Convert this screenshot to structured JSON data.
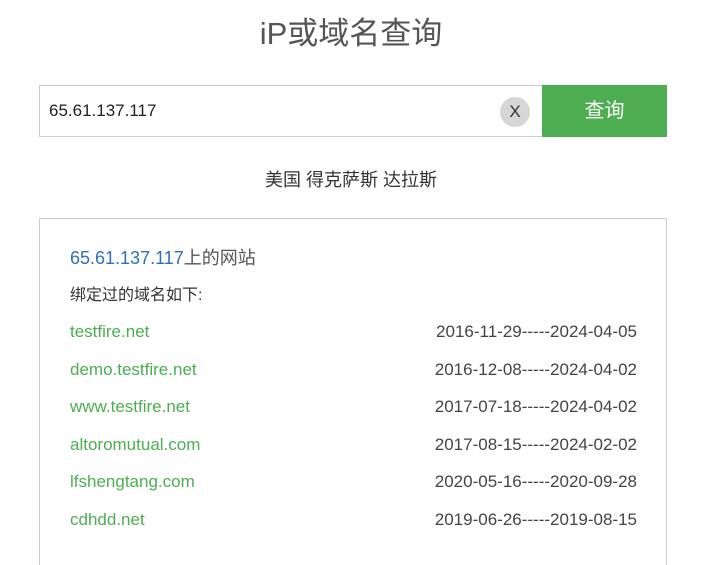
{
  "page": {
    "title": "iP或域名查询"
  },
  "search": {
    "value": "65.61.137.117",
    "clear_label": "X",
    "button_label": "查询"
  },
  "location": "美国 得克萨斯 达拉斯",
  "results": {
    "heading_ip": "65.61.137.117",
    "heading_suffix": "上的网站",
    "bound_label": "绑定过的域名如下:",
    "domains": [
      {
        "name": "testfire.net",
        "dates": "2016-11-29-----2024-04-05"
      },
      {
        "name": "demo.testfire.net",
        "dates": "2016-12-08-----2024-04-02"
      },
      {
        "name": "www.testfire.net",
        "dates": "2017-07-18-----2024-04-02"
      },
      {
        "name": "altoromutual.com",
        "dates": "2017-08-15-----2024-02-02"
      },
      {
        "name": "lfshengtang.com",
        "dates": "2020-05-16-----2020-09-28"
      },
      {
        "name": "cdhdd.net",
        "dates": "2019-06-26-----2019-08-15"
      }
    ]
  },
  "colors": {
    "accent_green": "#4cae50",
    "link_blue": "#2f6fba"
  }
}
